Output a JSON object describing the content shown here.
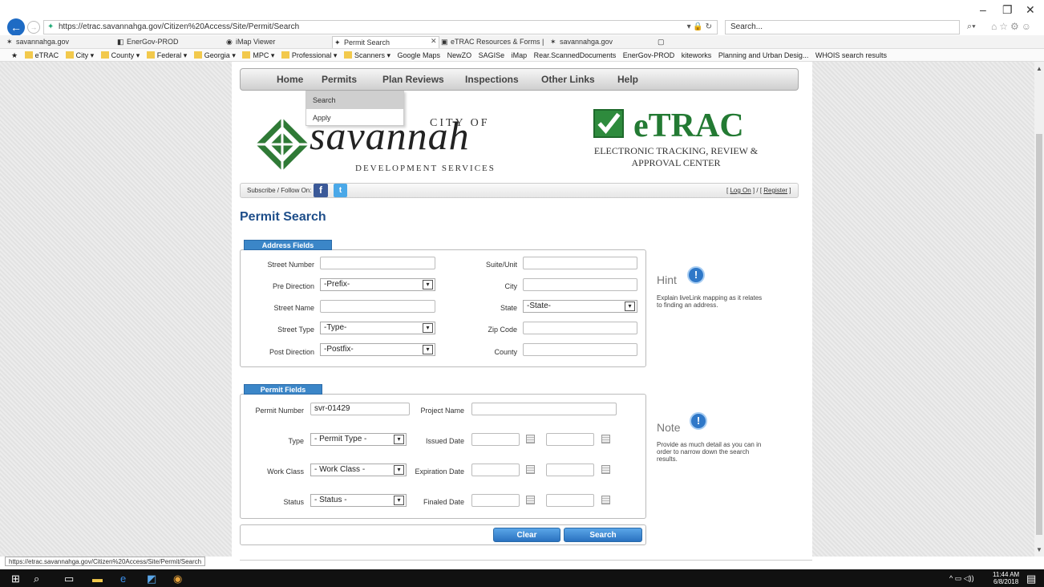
{
  "browser": {
    "url": "https://etrac.savannahga.gov/Citizen%20Access/Site/Permit/Search",
    "search_placeholder": "Search...",
    "tabs": [
      {
        "label": "savannahga.gov"
      },
      {
        "label": "EnerGov-PROD"
      },
      {
        "label": "iMap Viewer"
      },
      {
        "label": "Permit Search"
      },
      {
        "label": "eTRAC Resources & Forms | Sa..."
      },
      {
        "label": "savannahga.gov"
      }
    ],
    "favorites": [
      "eTRAC",
      "City ▾",
      "County ▾",
      "Federal ▾",
      "Georgia ▾",
      "MPC ▾",
      "Professional ▾",
      "Scanners ▾",
      "Google Maps",
      "NewZO",
      "SAGISe",
      "iMap",
      "Rear.ScannedDocuments",
      "EnerGov-PROD",
      "kiteworks",
      "Planning and Urban Desig...",
      "WHOIS search results"
    ],
    "status_url": "https://etrac.savannahga.gov/Citizen%20Access/Site/Permit/Search"
  },
  "nav": {
    "items": [
      "Home",
      "Permits",
      "Plan Reviews",
      "Inspections",
      "Other Links",
      "Help"
    ],
    "dropdown": [
      "Search",
      "Apply"
    ]
  },
  "banner": {
    "city_of": "CITY OF",
    "savannah": "savannah",
    "dev_services": "DEVELOPMENT SERVICES",
    "etrac": "eTRAC",
    "etrac_sub": "ELECTRONIC TRACKING, REVIEW & APPROVAL CENTER"
  },
  "subbar": {
    "subscribe": "Subscribe / Follow On:",
    "login": "Log On",
    "register": "Register"
  },
  "page_title": "Permit Search",
  "address": {
    "legend": "Address Fields",
    "street_number": {
      "label": "Street Number",
      "value": ""
    },
    "pre_direction": {
      "label": "Pre Direction",
      "value": "-Prefix-"
    },
    "street_name": {
      "label": "Street Name",
      "value": ""
    },
    "street_type": {
      "label": "Street Type",
      "value": "-Type-"
    },
    "post_direction": {
      "label": "Post Direction",
      "value": "-Postfix-"
    },
    "suite_unit": {
      "label": "Suite/Unit",
      "value": ""
    },
    "city": {
      "label": "City",
      "value": ""
    },
    "state": {
      "label": "State",
      "value": "-State-"
    },
    "zip_code": {
      "label": "Zip Code",
      "value": ""
    },
    "county": {
      "label": "County",
      "value": ""
    }
  },
  "hint": {
    "title": "Hint",
    "text": "Explain liveLink mapping as it relates to finding an address."
  },
  "permit": {
    "legend": "Permit Fields",
    "permit_number": {
      "label": "Permit Number",
      "value": "svr-01429"
    },
    "project_name": {
      "label": "Project Name",
      "value": ""
    },
    "type": {
      "label": "Type",
      "value": "- Permit Type -"
    },
    "issued_date": {
      "label": "Issued Date"
    },
    "work_class": {
      "label": "Work Class",
      "value": "- Work Class -"
    },
    "expiration_date": {
      "label": "Expiration Date"
    },
    "status": {
      "label": "Status",
      "value": "- Status -"
    },
    "finaled_date": {
      "label": "Finaled Date"
    }
  },
  "note": {
    "title": "Note",
    "text": "Provide as much detail as you can in order to narrow down the search results."
  },
  "buttons": {
    "clear": "Clear",
    "search": "Search"
  },
  "taskbar": {
    "time": "11:44 AM",
    "date": "6/8/2018"
  },
  "colors": {
    "nav_blue": "#1e4e8a",
    "legend_blue": "#3b86c8",
    "etrac_green": "#237a33"
  }
}
